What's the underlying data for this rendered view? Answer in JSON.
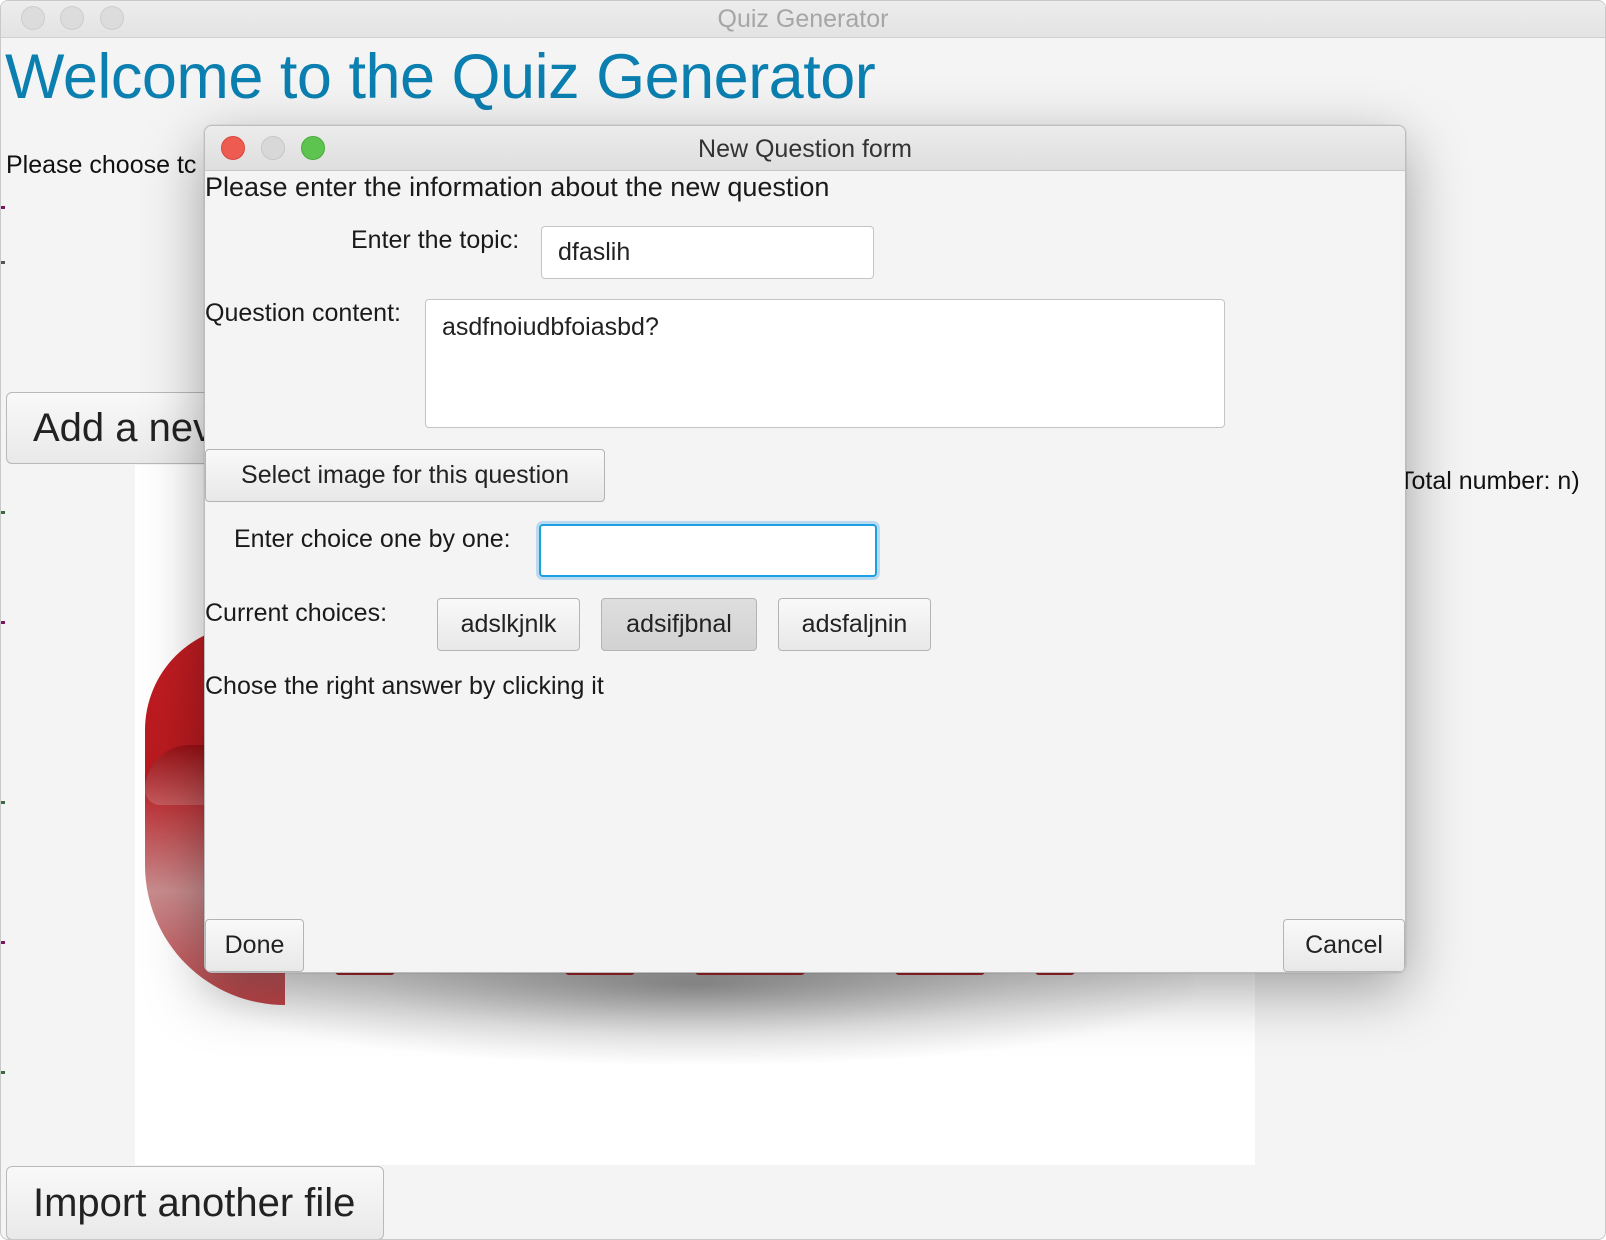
{
  "main_window": {
    "title": "Quiz Generator",
    "welcome": "Welcome to the Quiz Generator",
    "choose_prompt": "Please choose tс",
    "add_new_label": "Add a nev",
    "total_number": "Total number: n)",
    "import_label": "Import another file"
  },
  "dialog": {
    "title": "New Question form",
    "heading": "Please enter the information about the new question",
    "topic_label": "Enter the topic:",
    "topic_value": "dfaslih",
    "content_label": "Question content:",
    "content_value": "asdfnoiudbfoiasbd?",
    "select_image_label": "Select image for this question",
    "choice_label": "Enter choice one by one:",
    "choice_value": "",
    "current_choices_label": "Current choices:",
    "choices": [
      "adslkjnlk",
      "adsifjbnal",
      "adsfaljnin"
    ],
    "hint": "Chose the right answer by clicking it",
    "done_label": "Done",
    "cancel_label": "Cancel"
  },
  "colors": {
    "accent": "#0a7fb0",
    "focus_ring": "#1ba1e2",
    "close_dot": "#ee5b51",
    "zoom_dot": "#5dc44f"
  }
}
